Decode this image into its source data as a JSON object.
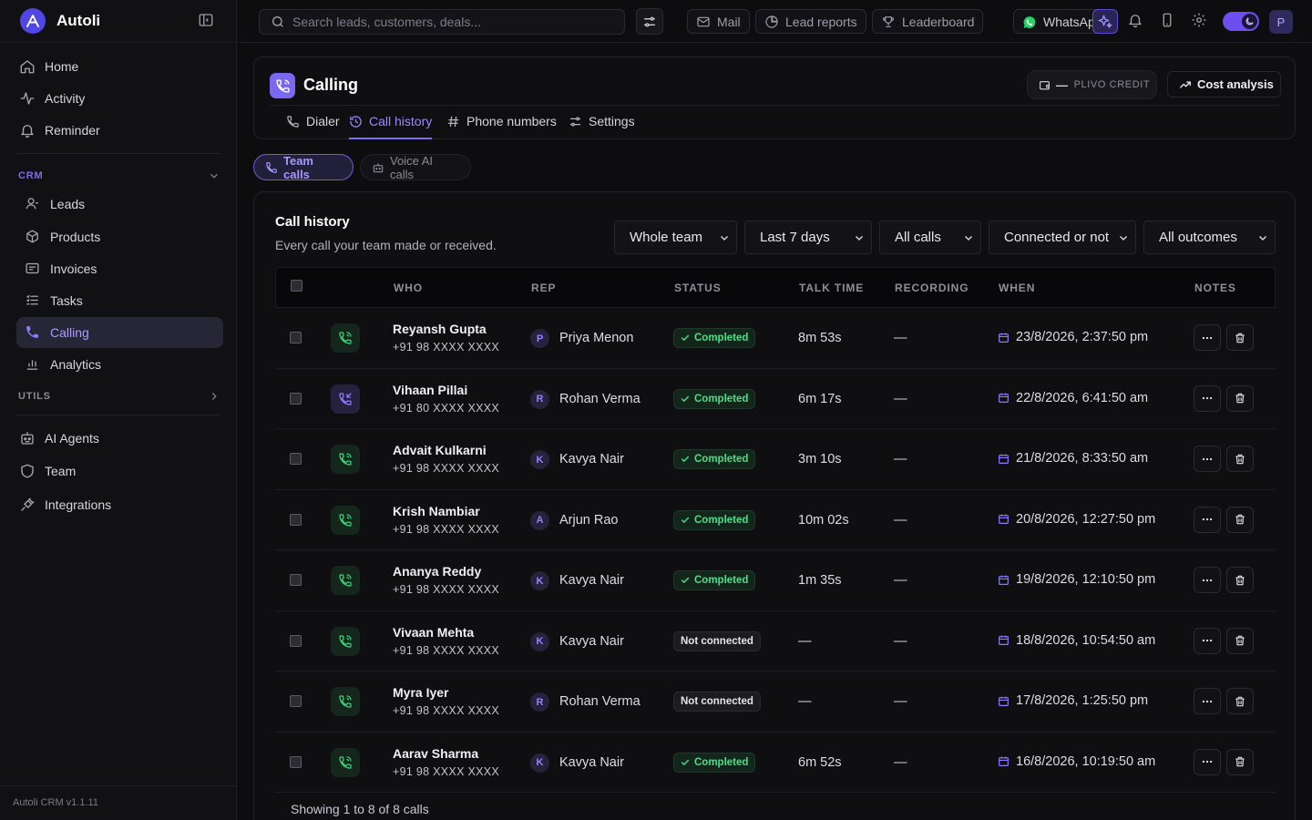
{
  "brand": {
    "name": "Autoli"
  },
  "sidebar": {
    "top_items": [
      {
        "label": "Home",
        "icon": "home-icon"
      },
      {
        "label": "Activity",
        "icon": "activity-icon"
      },
      {
        "label": "Reminder",
        "icon": "bell-icon"
      }
    ],
    "crm_label": "CRM",
    "crm_items": [
      {
        "label": "Leads",
        "icon": "leads-icon"
      },
      {
        "label": "Products",
        "icon": "box-icon"
      },
      {
        "label": "Invoices",
        "icon": "invoice-icon"
      },
      {
        "label": "Tasks",
        "icon": "tasks-icon"
      },
      {
        "label": "Calling",
        "icon": "phone-icon",
        "active": true
      },
      {
        "label": "Analytics",
        "icon": "bar-chart-icon"
      }
    ],
    "utils_label": "UTILS",
    "bottom_items": [
      {
        "label": "AI Agents",
        "icon": "robot-icon"
      },
      {
        "label": "Team",
        "icon": "shield-icon"
      },
      {
        "label": "Integrations",
        "icon": "plug-icon"
      }
    ],
    "version": "Autoli CRM v1.1.11"
  },
  "topbar": {
    "search_placeholder": "Search leads, customers, deals...",
    "buttons": [
      "Mail",
      "Lead reports",
      "Leaderboard",
      "WhatsApp"
    ],
    "avatar_initial": "P"
  },
  "calling": {
    "title": "Calling",
    "credit_label": "PLIVO CREDIT",
    "credit_value": "—",
    "cost_button": "Cost analysis",
    "tabs": [
      "Dialer",
      "Call history",
      "Phone numbers",
      "Settings"
    ],
    "active_tab": "Call history",
    "subtabs": [
      "Team calls",
      "Voice AI calls"
    ]
  },
  "history": {
    "title": "Call history",
    "subtitle": "Every call your team made or received.",
    "filters": [
      "Whole team",
      "Last 7 days",
      "All calls",
      "Connected or not",
      "All outcomes"
    ],
    "columns": [
      "WHO",
      "REP",
      "STATUS",
      "TALK TIME",
      "RECORDING",
      "WHEN",
      "NOTES"
    ],
    "rows": [
      {
        "name": "Reyansh Gupta",
        "phone": "+91 98 XXXX XXXX",
        "direction": "outgoing",
        "rep_initial": "P",
        "rep": "Priya Menon",
        "status": "Completed",
        "status_kind": "ok",
        "talk": "8m 53s",
        "recording": "—",
        "when": "23/8/2026, 2:37:50 pm"
      },
      {
        "name": "Vihaan Pillai",
        "phone": "+91 80 XXXX XXXX",
        "direction": "incoming",
        "rep_initial": "R",
        "rep": "Rohan Verma",
        "status": "Completed",
        "status_kind": "ok",
        "talk": "6m 17s",
        "recording": "—",
        "when": "22/8/2026, 6:41:50 am"
      },
      {
        "name": "Advait Kulkarni",
        "phone": "+91 98 XXXX XXXX",
        "direction": "outgoing",
        "rep_initial": "K",
        "rep": "Kavya Nair",
        "status": "Completed",
        "status_kind": "ok",
        "talk": "3m 10s",
        "recording": "—",
        "when": "21/8/2026, 8:33:50 am"
      },
      {
        "name": "Krish Nambiar",
        "phone": "+91 98 XXXX XXXX",
        "direction": "outgoing",
        "rep_initial": "A",
        "rep": "Arjun Rao",
        "status": "Completed",
        "status_kind": "ok",
        "talk": "10m 02s",
        "recording": "—",
        "when": "20/8/2026, 12:27:50 pm"
      },
      {
        "name": "Ananya Reddy",
        "phone": "+91 98 XXXX XXXX",
        "direction": "outgoing",
        "rep_initial": "K",
        "rep": "Kavya Nair",
        "status": "Completed",
        "status_kind": "ok",
        "talk": "1m 35s",
        "recording": "—",
        "when": "19/8/2026, 12:10:50 pm"
      },
      {
        "name": "Vivaan Mehta",
        "phone": "+91 98 XXXX XXXX",
        "direction": "outgoing",
        "rep_initial": "K",
        "rep": "Kavya Nair",
        "status": "Not connected",
        "status_kind": "no",
        "talk": "—",
        "recording": "—",
        "when": "18/8/2026, 10:54:50 am"
      },
      {
        "name": "Myra Iyer",
        "phone": "+91 98 XXXX XXXX",
        "direction": "outgoing",
        "rep_initial": "R",
        "rep": "Rohan Verma",
        "status": "Not connected",
        "status_kind": "no",
        "talk": "—",
        "recording": "—",
        "when": "17/8/2026, 1:25:50 pm"
      },
      {
        "name": "Aarav Sharma",
        "phone": "+91 98 XXXX XXXX",
        "direction": "outgoing",
        "rep_initial": "K",
        "rep": "Kavya Nair",
        "status": "Completed",
        "status_kind": "ok",
        "talk": "6m 52s",
        "recording": "—",
        "when": "16/8/2026, 10:19:50 am"
      }
    ],
    "footer": "Showing 1 to 8 of 8 calls"
  },
  "colors": {
    "accent": "#7c6cf0",
    "success": "#4fdc86",
    "background": "#0d0d10"
  }
}
